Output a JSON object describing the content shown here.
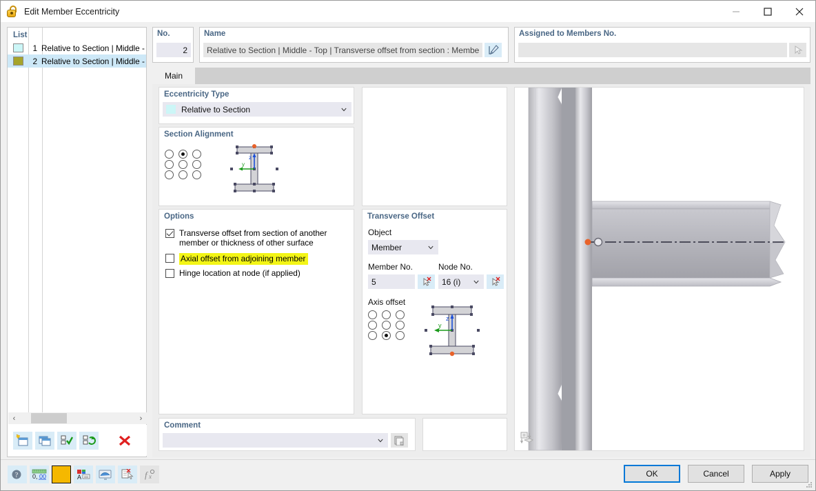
{
  "window": {
    "title": "Edit Member Eccentricity",
    "icon": "lock-icon",
    "minimize_label": "–",
    "maximize_label": "□",
    "close_label": "✕"
  },
  "list_panel": {
    "caption": "List",
    "rows": [
      {
        "no": "1",
        "label": "Relative to Section | Middle - To",
        "color": "#ccf6f7",
        "selected": false
      },
      {
        "no": "2",
        "label": "Relative to Section | Middle - To",
        "color": "#a6a42b",
        "selected": true
      }
    ],
    "scroll_left": "‹",
    "scroll_right": "›",
    "toolbar": [
      {
        "name": "new-item-button"
      },
      {
        "name": "copy-item-button"
      },
      {
        "name": "select-all-button"
      },
      {
        "name": "invert-selection-button"
      },
      {
        "name": "delete-item-button"
      }
    ]
  },
  "no_field": {
    "label": "No.",
    "value": "2"
  },
  "name_field": {
    "label": "Name",
    "value": "Relative to Section | Middle - Top | Transverse offset from section : Member No",
    "edit_button": "edit-name-button"
  },
  "assigned_field": {
    "label": "Assigned to Members No.",
    "value": "",
    "placeholder": "",
    "pick_button": "pick-members-button"
  },
  "tabs": [
    {
      "label": "Main",
      "active": true
    }
  ],
  "eccentricity_type": {
    "title": "Eccentricity Type",
    "value": "Relative to Section",
    "swatch_color": "#ccf6f7"
  },
  "section_alignment": {
    "title": "Section Alignment",
    "grid_selected_index": 1,
    "axis_z_label": "z",
    "axis_y_label": "y"
  },
  "options": {
    "title": "Options",
    "items": [
      {
        "label": "Transverse offset from section of another member or thickness of other surface",
        "checked": true,
        "highlighted": false
      },
      {
        "label": "Axial offset from adjoining member",
        "checked": false,
        "highlighted": true
      },
      {
        "label": "Hinge location at node (if applied)",
        "checked": false,
        "highlighted": false
      }
    ]
  },
  "transverse_offset": {
    "title": "Transverse Offset",
    "object_label": "Object",
    "object_value": "Member",
    "member_label": "Member No.",
    "member_value": "5",
    "node_label": "Node No.",
    "node_value": "16 (i)",
    "axis_offset_label": "Axis offset",
    "axis_grid_selected_index": 7,
    "axis_z_label": "z",
    "axis_y_label": "y"
  },
  "comment": {
    "title": "Comment",
    "value": "",
    "placeholder": ""
  },
  "view": {
    "name": "model-preview",
    "snapshot_button": "view-snapshot-button"
  },
  "footer": {
    "toolbar": [
      {
        "name": "info-button"
      },
      {
        "name": "numeric-format-button"
      },
      {
        "name": "color-swatch-button",
        "color": "#f5b800"
      },
      {
        "name": "legend-button"
      },
      {
        "name": "display-button"
      },
      {
        "name": "reset-button"
      },
      {
        "name": "formula-button"
      }
    ],
    "buttons": [
      {
        "label": "OK",
        "primary": true
      },
      {
        "label": "Cancel",
        "primary": false
      },
      {
        "label": "Apply",
        "primary": false
      }
    ]
  }
}
